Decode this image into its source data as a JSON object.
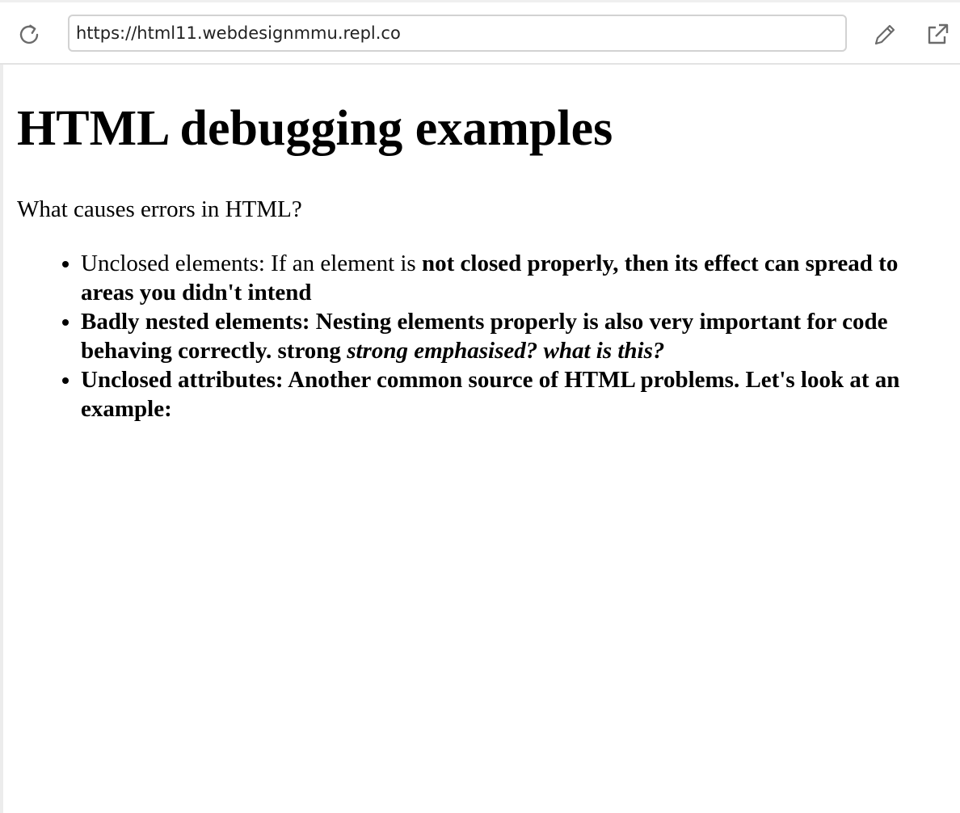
{
  "browser": {
    "url": "https://html11.webdesignmmu.repl.co",
    "icons": {
      "reload": "reload-icon",
      "edit": "pencil-icon",
      "open": "external-link-icon"
    }
  },
  "page": {
    "heading": "HTML debugging examples",
    "intro": "What causes errors in HTML?",
    "items": [
      {
        "plain": "Unclosed elements: If an element is ",
        "bold": "not closed properly, then its effect can spread to areas you didn't intend"
      },
      {
        "bold": "Badly nested elements: Nesting elements properly is also very important for code behaving correctly. strong ",
        "bold_italic": "strong emphasised? what is this?"
      },
      {
        "bold": "Unclosed attributes: Another common source of HTML problems. Let's look at an example:"
      }
    ]
  }
}
